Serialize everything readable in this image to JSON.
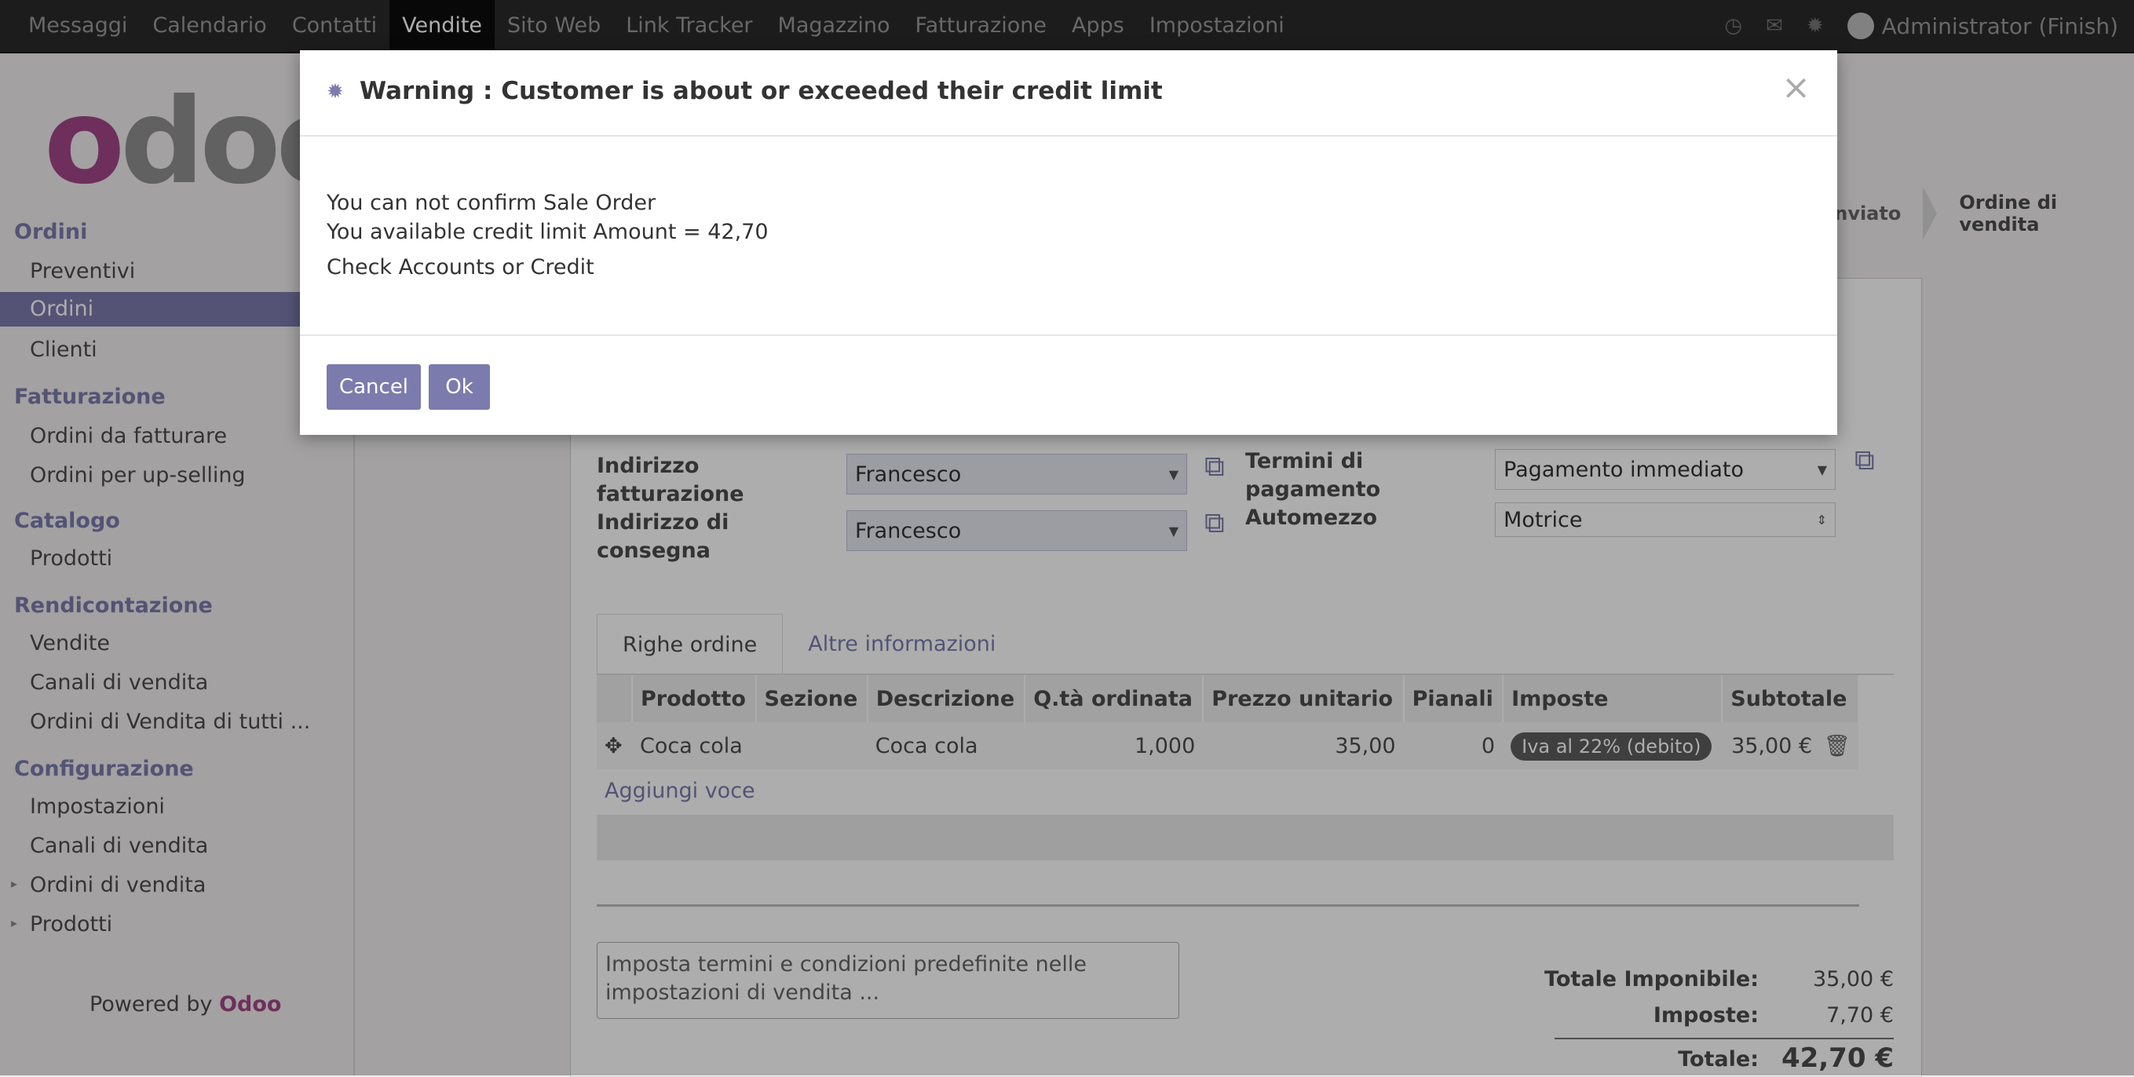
{
  "topbar": {
    "menu": [
      "Messaggi",
      "Calendario",
      "Contatti",
      "Vendite",
      "Sito Web",
      "Link Tracker",
      "Magazzino",
      "Fatturazione",
      "Apps",
      "Impostazioni"
    ],
    "active": "Vendite",
    "icons": [
      "clock-icon",
      "chat-icon",
      "bug-icon"
    ],
    "user": "Administrator (Finish)"
  },
  "sidebar": {
    "sections": [
      {
        "title": "Ordini",
        "items": [
          {
            "label": "Preventivi"
          },
          {
            "label": "Ordini",
            "active": true
          },
          {
            "label": "Clienti"
          }
        ]
      },
      {
        "title": "Fatturazione",
        "items": [
          {
            "label": "Ordini da fatturare"
          },
          {
            "label": "Ordini per up-selling"
          }
        ]
      },
      {
        "title": "Catalogo",
        "items": [
          {
            "label": "Prodotti"
          }
        ]
      },
      {
        "title": "Rendicontazione",
        "items": [
          {
            "label": "Vendite"
          },
          {
            "label": "Canali di vendita"
          },
          {
            "label": "Ordini di Vendita di tutti ..."
          }
        ]
      },
      {
        "title": "Configurazione",
        "items": [
          {
            "label": "Impostazioni"
          },
          {
            "label": "Canali di vendita"
          },
          {
            "label": "Ordini di vendita",
            "expandable": true
          },
          {
            "label": "Prodotti",
            "expandable": true
          }
        ]
      }
    ],
    "powered_prefix": "Powered by",
    "powered_brand": "Odoo",
    "logo_text": "odoo"
  },
  "breadcrumb": {
    "items": [
      "inviato",
      "Ordine di vendita"
    ]
  },
  "form": {
    "invoice_address_label": "Indirizzo fatturazione",
    "invoice_address_value": "Francesco",
    "delivery_address_label": "Indirizzo di consegna",
    "delivery_address_value": "Francesco",
    "payment_terms_label": "Termini di pagamento",
    "payment_terms_value": "Pagamento immediato",
    "vehicle_label": "Automezzo",
    "vehicle_value": "Motrice"
  },
  "tabs": [
    "Righe ordine",
    "Altre informazioni"
  ],
  "order_lines": {
    "headers": [
      "Prodotto",
      "Sezione",
      "Descrizione",
      "Q.tà ordinata",
      "Prezzo unitario",
      "Pianali",
      "Imposte",
      "Subtotale"
    ],
    "rows": [
      {
        "product": "Coca cola",
        "section": "",
        "description": "Coca cola",
        "qty": "1,000",
        "price": "35,00",
        "pianali": "0",
        "tax": "Iva al 22% (debito)",
        "subtotal": "35,00 €"
      }
    ],
    "add_line": "Aggiungi voce"
  },
  "terms_placeholder": "Imposta termini e condizioni predefinite nelle impostazioni di vendita ...",
  "totals": {
    "untaxed_label": "Totale Imponibile:",
    "untaxed_value": "35,00 €",
    "taxes_label": "Imposte:",
    "taxes_value": "7,70 €",
    "total_label": "Totale:",
    "total_value": "42,70 €"
  },
  "dialog": {
    "title": "Warning : Customer is about or exceeded their credit limit",
    "line1": "You can not confirm Sale Order",
    "line2": "You available credit limit Amount = 42,70",
    "line3": "Check Accounts or Credit",
    "cancel_label": "Cancel",
    "ok_label": "Ok",
    "close_glyph": "×"
  },
  "colors": {
    "accent": "#7c7bad",
    "brand": "#a24689",
    "topbar": "#2a2a2a"
  }
}
